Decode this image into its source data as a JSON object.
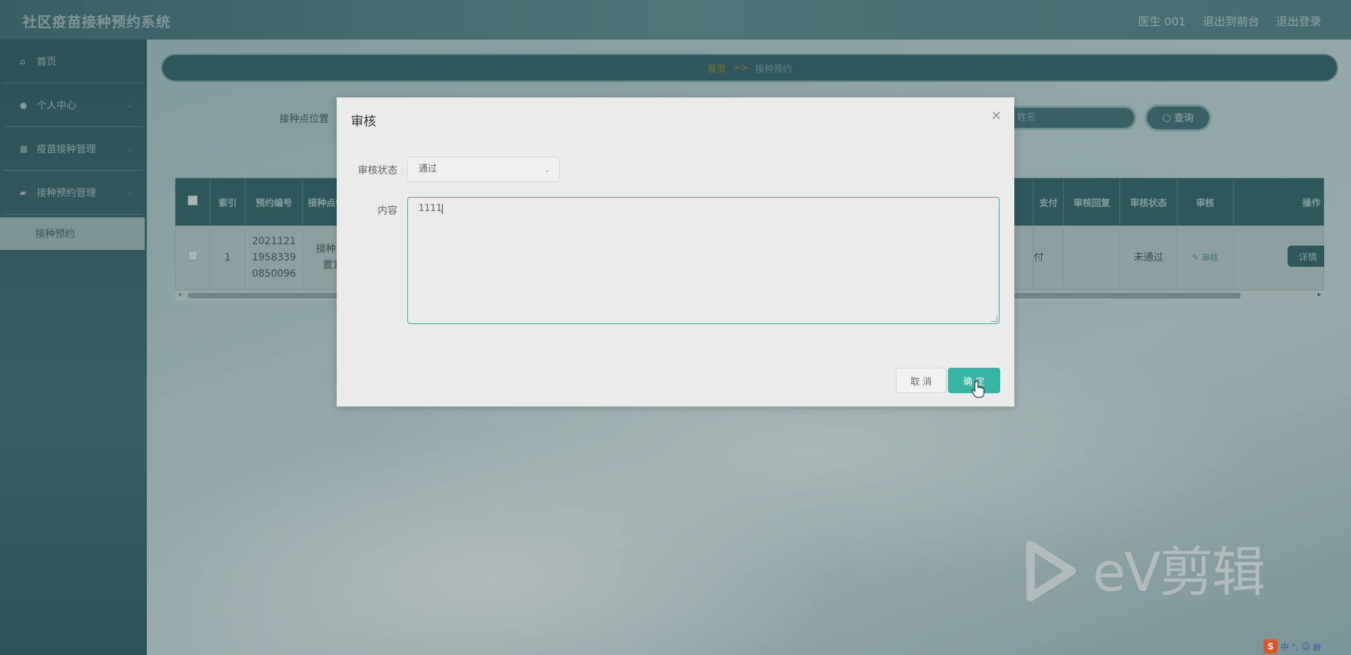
{
  "header": {
    "title": "社区疫苗接种预约系统",
    "links": [
      "医生 001",
      "退出到前台",
      "退出登录"
    ]
  },
  "sidebar": {
    "items": [
      {
        "label": "首页",
        "icon": "home-icon"
      },
      {
        "label": "个人中心",
        "icon": "user-icon"
      },
      {
        "label": "疫苗接种管理",
        "icon": "grid-icon"
      },
      {
        "label": "接种预约管理",
        "icon": "briefcase-icon"
      }
    ],
    "sub_item": "接种预约"
  },
  "breadcrumb": {
    "home": "首页",
    "separator": ">>",
    "current": "接种预约"
  },
  "search": {
    "label": "接种点位置",
    "placeholder": "姓名",
    "button": "查询"
  },
  "table": {
    "headers": [
      "",
      "索引",
      "预约编号",
      "接种点位置",
      "",
      "支付",
      "审核回复",
      "审核状态",
      "审核",
      "操作"
    ],
    "row": {
      "index": "1",
      "booking_no_lines": [
        "2021121",
        "1958339",
        "0850096"
      ],
      "location_lines": [
        "接种点",
        "置1"
      ],
      "pay": "付",
      "reply": "",
      "status": "未通过",
      "audit": "审核",
      "action": "详情"
    }
  },
  "dialog": {
    "title": "审核",
    "status_label": "审核状态",
    "status_value": "通过",
    "content_label": "内容",
    "content_value": "1111",
    "cancel": "取 消",
    "ok": "确 定"
  },
  "watermark": {
    "text": "eV剪辑"
  },
  "ime": {
    "s": "S",
    "chars": "中 °,"
  }
}
